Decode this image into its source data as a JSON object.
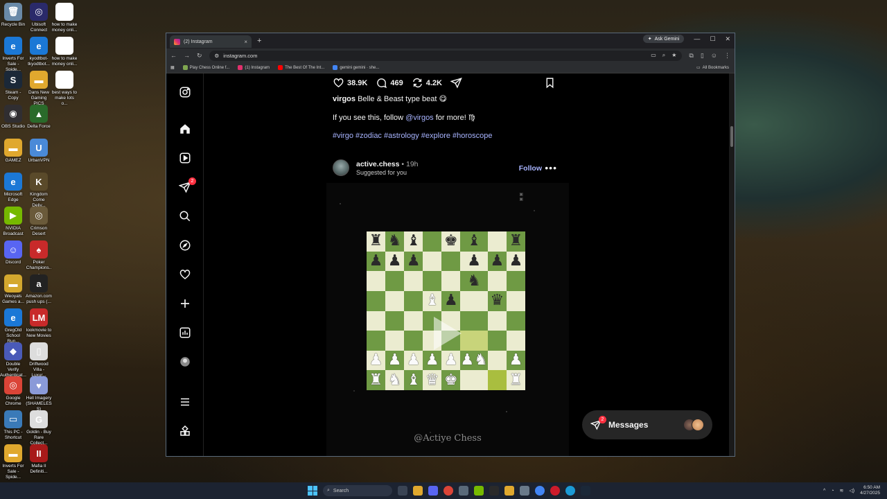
{
  "desktop_icons_left": [
    {
      "label": "Recycle Bin",
      "color": "#6a8aa8",
      "glyph": "🗑"
    },
    {
      "label": "Inverts For Sale - Spide...",
      "color": "#1b78d6",
      "glyph": "e"
    },
    {
      "label": "Steam - Copy",
      "color": "#1b2838",
      "glyph": "S"
    },
    {
      "label": "OBS Studio",
      "color": "#302e31",
      "glyph": "◉"
    },
    {
      "label": "GAMEZ",
      "color": "#e0a82e",
      "glyph": "▬"
    },
    {
      "label": "Microsoft Edge",
      "color": "#1b78d6",
      "glyph": "e"
    },
    {
      "label": "NVIDIA Broadcast",
      "color": "#76b900",
      "glyph": "▶"
    },
    {
      "label": "Discord",
      "color": "#5865f2",
      "glyph": "☺"
    },
    {
      "label": "Weoyals Games a...",
      "color": "#d4a82e",
      "glyph": "▬"
    },
    {
      "label": "GregOld School Run...",
      "color": "#1b78d6",
      "glyph": "e"
    },
    {
      "label": "Double Verify Authenticat...",
      "color": "#4a5ab8",
      "glyph": "◆"
    },
    {
      "label": "Google Chrome",
      "color": "#db4437",
      "glyph": "◎"
    },
    {
      "label": "This PC - Shortcut",
      "color": "#3a7ab8",
      "glyph": "▭"
    },
    {
      "label": "Inverts For Sale - Spide...",
      "color": "#e0a82e",
      "glyph": "▬"
    }
  ],
  "desktop_icons_right": [
    {
      "label": "Ubisoft Connect",
      "color": "#2a2a6a",
      "glyph": "◎"
    },
    {
      "label": "kyodtbot-tkyodtbot...",
      "color": "#1b78d6",
      "glyph": "e"
    },
    {
      "label": "Dans New Gaming PICS",
      "color": "#e0a82e",
      "glyph": "▬"
    },
    {
      "label": "Delta Force",
      "color": "#2a6a2a",
      "glyph": "▲"
    },
    {
      "label": "UrbanVPN",
      "color": "#4a8ad8",
      "glyph": "U"
    },
    {
      "label": "Kingdom Come Deliv...",
      "color": "#5a4a2a",
      "glyph": "K"
    },
    {
      "label": "Crimson Desert",
      "color": "#6a5a3a",
      "glyph": "◎"
    },
    {
      "label": "Poker Champions...",
      "color": "#c82a2a",
      "glyph": "♠"
    },
    {
      "label": "Amazon.com push ups (...",
      "color": "#222222",
      "glyph": "a"
    },
    {
      "label": "lookmovie to New Movies",
      "color": "#c82a2a",
      "glyph": "LM"
    },
    {
      "label": "Driftwood Villa - Luxur...",
      "color": "#dddddd",
      "glyph": "▯"
    },
    {
      "label": "Hell Imagery (SHAMELESS)",
      "color": "#8a9ad8",
      "glyph": "♥"
    },
    {
      "label": "Goldin - Buy Rare Collect...",
      "color": "#dddddd",
      "glyph": "G"
    },
    {
      "label": "Mafia II Definiti...",
      "color": "#a81a1a",
      "glyph": "II"
    }
  ],
  "desktop_icons_third": [
    {
      "label": "how to make money onli...",
      "color": "#ffffff",
      "glyph": "G"
    },
    {
      "label": "how to make money onli...",
      "color": "#ffffff",
      "glyph": "G"
    },
    {
      "label": "best ways to make lots o...",
      "color": "#ffffff",
      "glyph": "G"
    }
  ],
  "browser": {
    "tab_title": "(2) Instagram",
    "tab_close": "×",
    "new_tab": "+",
    "ask_gemini": "Ask Gemini",
    "url": "instagram.com",
    "bookmarks": [
      {
        "label": "Play Chess Online f...",
        "color": "#7fa650"
      },
      {
        "label": "(1) Instagram",
        "color": "#e1306c"
      },
      {
        "label": "The Best Of The Int...",
        "color": "#ff0000"
      },
      {
        "label": "gemini gemini · she...",
        "color": "#4285f4"
      }
    ],
    "all_bookmarks": "All Bookmarks"
  },
  "post_top": {
    "likes": "38.9K",
    "comments": "469",
    "shares": "4.2K",
    "caption_user": "virgos",
    "caption_text": "Belle & Beast type beat 😋",
    "line2_before": "If you see this, follow ",
    "line2_mention": "@virgos",
    "line2_after": " for more! ♍",
    "hashtags": "#virgo #zodiac #astrology #explore #horoscope"
  },
  "post": {
    "username": "active.chess",
    "time": " • 19h",
    "suggested": "Suggested for you",
    "follow": "Follow",
    "more": "•••",
    "watermark": "@Actiye Chess"
  },
  "board": [
    [
      "bR",
      "bN",
      "bB",
      "",
      "bK",
      "bB",
      "",
      "bR"
    ],
    [
      "bP",
      "bP",
      "bP",
      "",
      "",
      "bP",
      "bP",
      "bP"
    ],
    [
      "",
      "",
      "",
      "",
      "",
      "bN",
      "",
      ""
    ],
    [
      "",
      "",
      "",
      "wB",
      "bP",
      "",
      "bQ",
      ""
    ],
    [
      "",
      "",
      "",
      "",
      "",
      "",
      "",
      ""
    ],
    [
      "",
      "",
      "",
      "",
      "",
      "",
      "",
      ""
    ],
    [
      "wP",
      "wP",
      "wP",
      "wP",
      "wP",
      "wP wN",
      "",
      "wP"
    ],
    [
      "wR",
      "wN",
      "wB",
      "wQ",
      "wK",
      "",
      "",
      "wR"
    ]
  ],
  "highlights": [
    "5-5",
    "7-6"
  ],
  "messages": {
    "label": "Messages",
    "badge": "2"
  },
  "nav": {
    "notif_badge": "2"
  },
  "taskbar": {
    "search": "Search",
    "time": "6:50 AM",
    "date": "4/27/2025"
  }
}
